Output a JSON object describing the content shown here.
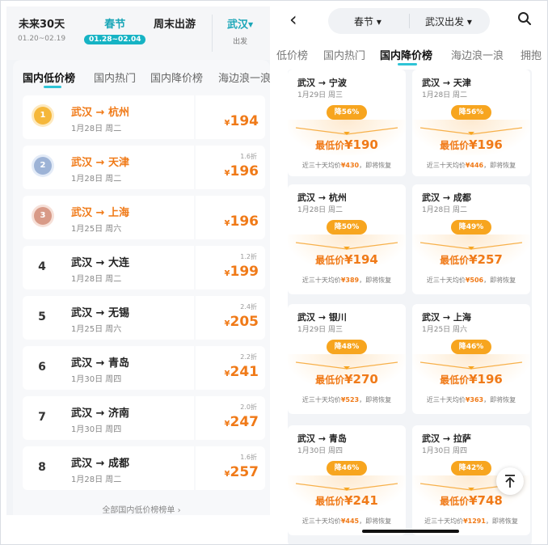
{
  "left": {
    "date_options": [
      {
        "title": "未来30天",
        "sub": "01.20~02.19"
      },
      {
        "title": "春节",
        "sub": "01.28~02.04"
      },
      {
        "title": "周末出游",
        "sub": ""
      }
    ],
    "city": {
      "name": "武汉",
      "sub": "出发"
    },
    "tabs": [
      "国内低价榜",
      "国内热门",
      "国内降价榜",
      "海边浪一浪"
    ],
    "rows": [
      {
        "rank": "1",
        "route": "武汉 → 杭州",
        "date": "1月28日 周二",
        "discount": "",
        "price": "194"
      },
      {
        "rank": "2",
        "route": "武汉 → 天津",
        "date": "1月28日 周二",
        "discount": "1.6折",
        "price": "196"
      },
      {
        "rank": "3",
        "route": "武汉 → 上海",
        "date": "1月25日 周六",
        "discount": "",
        "price": "196"
      },
      {
        "rank": "4",
        "route": "武汉 → 大连",
        "date": "1月28日 周二",
        "discount": "1.2折",
        "price": "199"
      },
      {
        "rank": "5",
        "route": "武汉 → 无锡",
        "date": "1月25日 周六",
        "discount": "2.4折",
        "price": "205"
      },
      {
        "rank": "6",
        "route": "武汉 → 青岛",
        "date": "1月30日 周四",
        "discount": "2.2折",
        "price": "241"
      },
      {
        "rank": "7",
        "route": "武汉 → 济南",
        "date": "1月30日 周四",
        "discount": "2.0折",
        "price": "247"
      },
      {
        "rank": "8",
        "route": "武汉 → 成都",
        "date": "1月28日 周二",
        "discount": "1.6折",
        "price": "257"
      }
    ],
    "all_link": "全部国内低价榜榜单 ›"
  },
  "right": {
    "filter_holiday": "春节 ▾",
    "filter_city": "武汉出发 ▾",
    "tabs": [
      "低价榜",
      "国内热门",
      "国内降价榜",
      "海边浪一浪",
      "拥抱"
    ],
    "low_label": "最低价",
    "cards": [
      {
        "route": "武汉 → 宁波",
        "date": "1月29日 周三",
        "drop": "降56%",
        "price": "¥190",
        "avg": "¥430"
      },
      {
        "route": "武汉 → 天津",
        "date": "1月28日 周二",
        "drop": "降56%",
        "price": "¥196",
        "avg": "¥446"
      },
      {
        "route": "武汉 → 杭州",
        "date": "1月28日 周二",
        "drop": "降50%",
        "price": "¥194",
        "avg": "¥389"
      },
      {
        "route": "武汉 → 成都",
        "date": "1月28日 周二",
        "drop": "降49%",
        "price": "¥257",
        "avg": "¥506"
      },
      {
        "route": "武汉 → 银川",
        "date": "1月29日 周三",
        "drop": "降48%",
        "price": "¥270",
        "avg": "¥523"
      },
      {
        "route": "武汉 → 上海",
        "date": "1月25日 周六",
        "drop": "降46%",
        "price": "¥196",
        "avg": "¥363"
      },
      {
        "route": "武汉 → 青岛",
        "date": "1月30日 周四",
        "drop": "降46%",
        "price": "¥241",
        "avg": "¥445"
      },
      {
        "route": "武汉 → 拉萨",
        "date": "1月30日 周四",
        "drop": "降42%",
        "price": "¥748",
        "avg": "¥1291"
      }
    ],
    "avg_prefix": "近三十天均价",
    "avg_suffix": "，即将恢复"
  },
  "colors": {
    "accent": "#1aa6b7",
    "price": "#f07a18",
    "badge": "#f7a51f"
  }
}
